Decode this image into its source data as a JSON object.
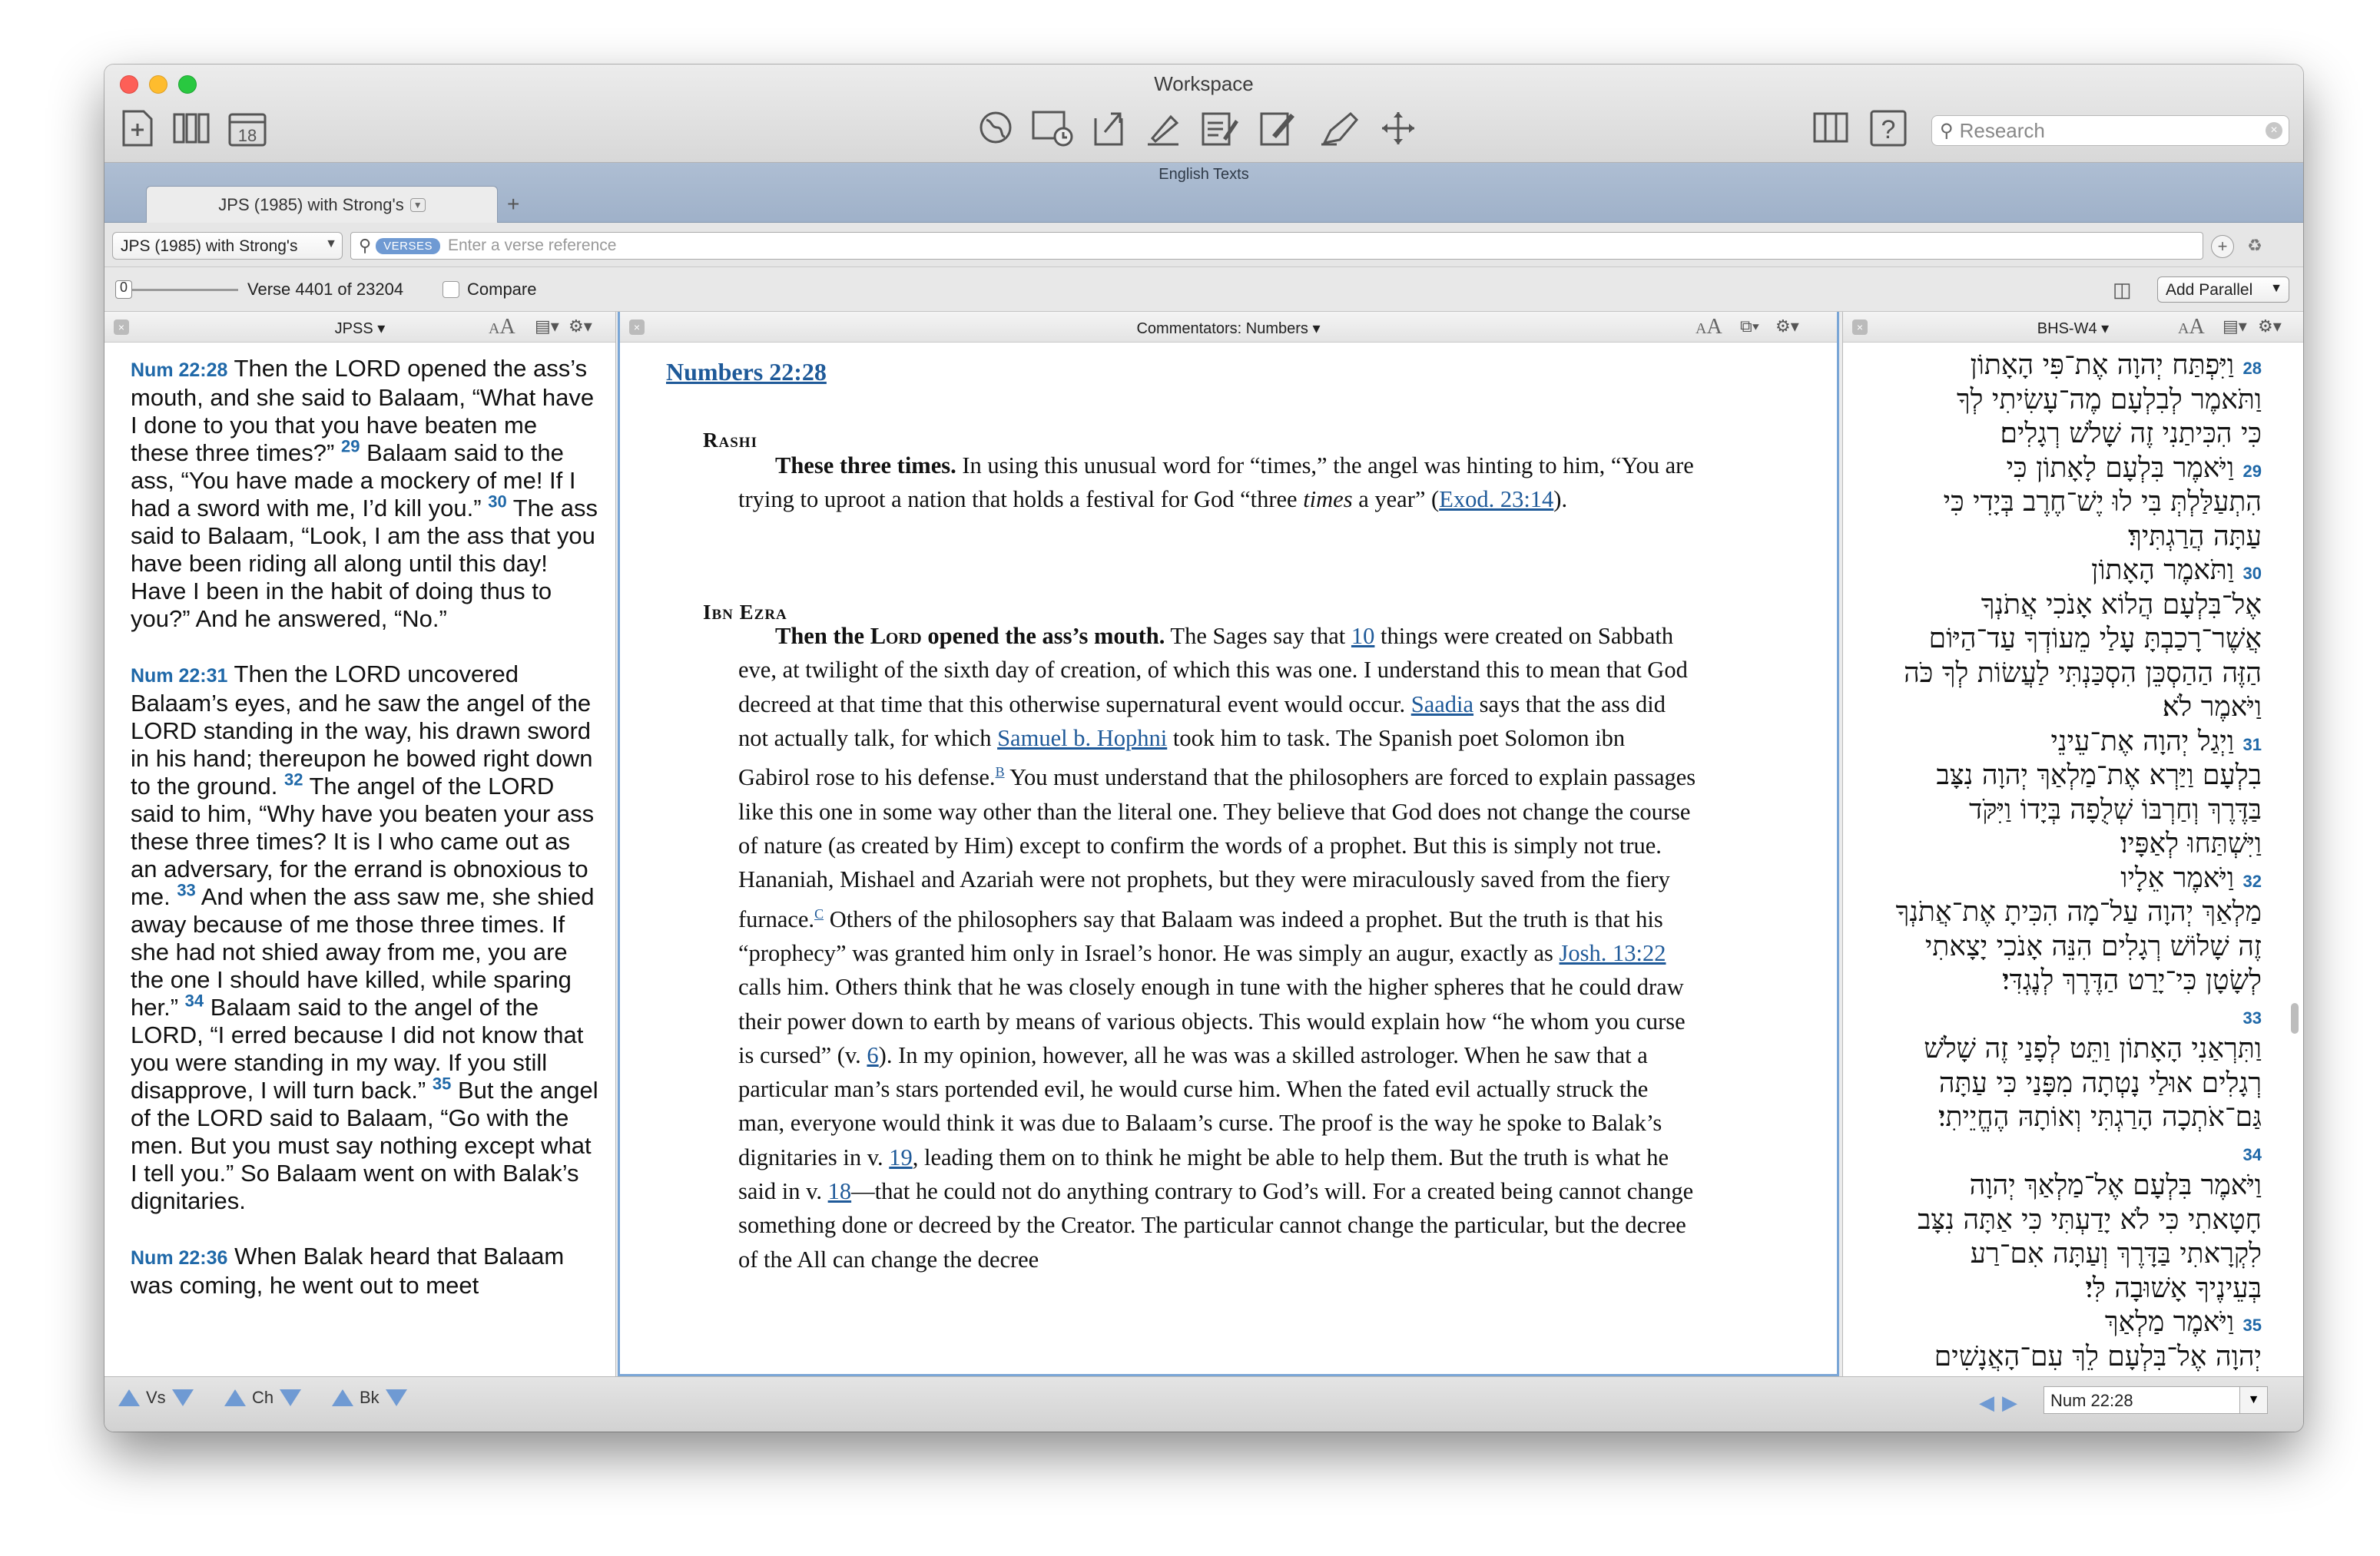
{
  "window": {
    "title": "Workspace"
  },
  "toolbar": {
    "left_icons": [
      "new-document-icon",
      "library-icon",
      "calendar-icon"
    ],
    "calendar_day": "18",
    "center_icons": [
      "globe-icon",
      "media-browser-icon",
      "export-icon",
      "highlighter-icon",
      "note-icon",
      "edit-note-icon",
      "pen-icon",
      "move-icon"
    ],
    "right_icons": [
      "layout-icon",
      "help-icon"
    ],
    "research_placeholder": "Research"
  },
  "tabstrip": {
    "title": "English Texts",
    "tab_label": "JPS (1985) with Strong's",
    "add_label": "+"
  },
  "search": {
    "resource": "JPS (1985) with Strong's",
    "mode_pill": "VERSES",
    "placeholder": "Enter a verse reference"
  },
  "verse_bar": {
    "slider_value": "0",
    "verse_count": "Verse 4401 of 23204",
    "compare_label": "Compare",
    "add_parallel_label": "Add Parallel"
  },
  "panes": {
    "left": {
      "title": "JPSS",
      "verses": [
        {
          "ref": "Num 22:28",
          "segments": [
            {
              "n": "",
              "t": "Then the LORD opened the ass’s mouth, and she said to Balaam, “What have I done to you that you have beaten me these three times?”"
            },
            {
              "n": "29",
              "t": "Balaam said to the ass, “You have made a mockery of me! If I had a sword with me, I’d kill you.”"
            },
            {
              "n": "30",
              "t": "The ass said to Balaam, “Look, I am the ass that you have been riding all along until this day! Have I been in the habit of doing thus to you?” And he answered, “No.”"
            }
          ]
        },
        {
          "ref": "Num 22:31",
          "segments": [
            {
              "n": "",
              "t": "Then the LORD uncovered Balaam’s eyes, and he saw the angel of the LORD standing in the way, his drawn sword in his hand; thereupon he bowed right down to the ground."
            },
            {
              "n": "32",
              "t": "The angel of the LORD said to him, “Why have you beaten your ass these three times? It is I who came out as an adversary, for the errand is obnoxious to me."
            },
            {
              "n": "33",
              "t": "And when the ass saw me, she shied away because of me those three times. If she had not shied away from me, you are the one I should have killed, while sparing her.”"
            },
            {
              "n": "34",
              "t": "Balaam said to the angel of the LORD, “I erred because I did not know that you were standing in my way. If you still disapprove, I will turn back.”"
            },
            {
              "n": "35",
              "t": "But the angel of the LORD said to Balaam, “Go with the men. But you must say nothing except what I tell you.” So Balaam went on with Balak’s dignitaries."
            }
          ]
        },
        {
          "ref": "Num 22:36",
          "segments": [
            {
              "n": "",
              "t": "When Balak heard that Balaam was coming, he went out to meet"
            }
          ]
        }
      ]
    },
    "middle": {
      "title": "Commentators: Numbers",
      "heading": "Numbers 22:28",
      "rashi": {
        "author": "Rashi",
        "lemma": "These three times.",
        "text_1": " In using this unusual word for “times,” the angel was hinting to him, “You are trying to uproot a nation that holds a festival for God “three ",
        "italic": "times",
        "text_2": " a year” (",
        "link": "Exod. 23:14",
        "text_3": ")."
      },
      "ibn_ezra": {
        "author": "Ibn Ezra",
        "lemma_pre": "Then the ",
        "lemma_lord": "Lord",
        "lemma_post": " opened the ass’s mouth.",
        "t1": " The Sages say that ",
        "l1": "10",
        "t2": " things were created on Sabbath eve, at twilight of the sixth day of creation, of which this was one. I understand this to mean that God decreed at that time that this otherwise supernatural event would occur. ",
        "l2": "Saadia",
        "t3": " says that the ass did not actually talk, for which ",
        "l3": "Samuel b. Hophni",
        "t4": " took him to task. The Spanish poet Solomon ibn Gabirol rose to his defense.",
        "fn1": "B",
        "t5": " You must understand that the philosophers are forced to explain passages like this one in some way other than the literal one. They believe that God does not change the course of nature (as created by Him) except to confirm the words of a prophet. But this is simply not true. Hananiah, Mishael and Azariah were not prophets, but they were miraculously saved from the fiery furnace.",
        "fn2": "C",
        "t6": " Others of the philosophers say that Balaam was indeed a prophet. But the truth is that his “prophecy” was granted him only in Israel’s honor. He was simply an augur, exactly as ",
        "l4": "Josh. 13:22",
        "t7": " calls him. Others think that he was closely enough in tune with the higher spheres that he could draw their power down to earth by means of various objects. This would explain how “he whom you curse is cursed” (v. ",
        "l5": "6",
        "t8": "). In my opinion, however, all he was was a skilled astrologer. When he saw that a particular man’s stars portended evil, he would curse him. When the fated evil actually struck the man, everyone would think it was due to Balaam’s curse. The proof is the way he spoke to Balak’s dignitaries in v. ",
        "l6": "19",
        "t9": ", leading them on to think he might be able to help them. But the truth is what he said in v. ",
        "l7": "18",
        "t10": "—that he could not do anything contrary to God’s will. For a created being cannot change something done or decreed by the Creator. The particular cannot change the particular, but the decree of the All can change the decree"
      }
    },
    "right": {
      "title": "BHS-W4",
      "lines": [
        {
          "n": "28",
          "t": "וַיִּפְתַּח יְהוָה אֶת־פִּי הָאָתוֹן"
        },
        {
          "n": "",
          "t": "וַתֹּאמֶר לְבִלְעָם מֶה־עָשִׂיתִי לְךָ"
        },
        {
          "n": "",
          "t": "כִּי הִכִּיתַנִי זֶה שָׁלֹשׁ רְגָלִים׃"
        },
        {
          "n": "29",
          "t": "וַיֹּאמֶר בִּלְעָם לָאָתוֹן כִּי"
        },
        {
          "n": "",
          "t": "הִתְעַלַּלְתְּ בִּי לוּ יֶשׁ־חֶרֶב בְּיָדִי כִּי"
        },
        {
          "n": "",
          "t": "עַתָּה הֲרַגְתִּיךְ׃"
        },
        {
          "n": "30",
          "t": "וַתֹּאמֶר הָאָתוֹן"
        },
        {
          "n": "",
          "t": "אֶל־בִּלְעָם הֲלוֹא אָנֹכִי אֲתֹנְךָ"
        },
        {
          "n": "",
          "t": "אֲשֶׁר־רָכַבְתָּ עָלַי מֵעוֹדְךָ עַד־הַיּוֹם"
        },
        {
          "n": "",
          "t": "הַזֶּה הַהַסְכֵּן הִסְכַּנְתִּי לַעֲשׂוֹת לְךָ כֹּה"
        },
        {
          "n": "",
          "t": "וַיֹּאמֶר לֹא׃"
        },
        {
          "n": "31",
          "t": "וַיְגַל יְהוָה אֶת־עֵינֵי"
        },
        {
          "n": "",
          "t": "בִלְעָם וַיַּרְא אֶת־מַלְאַךְ יְהוָה נִצָּב"
        },
        {
          "n": "",
          "t": "בַּדֶּרֶךְ וְחַרְבּוֹ שְׁלֻפָה בְּיָדוֹ וַיִּקֹּד"
        },
        {
          "n": "",
          "t": "וַיִּשְׁתַּחוּ לְאַפָּיו׃"
        },
        {
          "n": "32",
          "t": "וַיֹּאמֶר אֵלָיו"
        },
        {
          "n": "",
          "t": "מַלְאַךְ יְהוָה עַל־מָה הִכִּיתָ אֶת־אֲתֹנְךָ"
        },
        {
          "n": "",
          "t": "זֶה שָׁלוֹשׁ רְגָלִים הִנֵּה אָנֹכִי יָצָאתִי"
        },
        {
          "n": "",
          "t": "לְשָׂטָן כִּי־יָרַט הַדֶּרֶךְ לְנֶגְדִּי׃"
        },
        {
          "n": "33",
          "t": ""
        },
        {
          "n": "",
          "t": "וַתִּרְאַנִי הָאָתוֹן וַתֵּט לְפָנַי זֶה שָׁלֹשׁ"
        },
        {
          "n": "",
          "t": "רְגָלִים אוּלַי נָטְתָה מִפָּנַי כִּי עַתָּה"
        },
        {
          "n": "",
          "t": "גַּם־אֹתְכָה הָרַגְתִּי וְאוֹתָהּ הֶחֱיֵיתִי׃"
        },
        {
          "n": "34",
          "t": ""
        },
        {
          "n": "",
          "t": "וַיֹּאמֶר בִּלְעָם אֶל־מַלְאַךְ יְהוָה"
        },
        {
          "n": "",
          "t": "חָטָאתִי כִּי לֹא יָדַעְתִּי כִּי אַתָּה נִצָּב"
        },
        {
          "n": "",
          "t": "לִקְרָאתִי בַּדָּרֶךְ וְעַתָּה אִם־רַע"
        },
        {
          "n": "",
          "t": "בְּעֵינֶיךָ אָשׁוּבָה לִּי׃"
        },
        {
          "n": "35",
          "t": "וַיֹּאמֶר מַלְאַךְ"
        },
        {
          "n": "",
          "t": "יְהוָה אֶל־בִּלְעָם לֵךְ עִם־הָאֲנָשִׁים"
        }
      ]
    }
  },
  "bottom": {
    "verse_label": "Vs",
    "chapter_label": "Ch",
    "book_label": "Bk",
    "reference": "Num 22:28"
  },
  "colors": {
    "link": "#1f5a99",
    "verse_number": "#1f68a8",
    "tab_strip": "#a6b7cd",
    "active_pane": "#7aa6d6"
  }
}
